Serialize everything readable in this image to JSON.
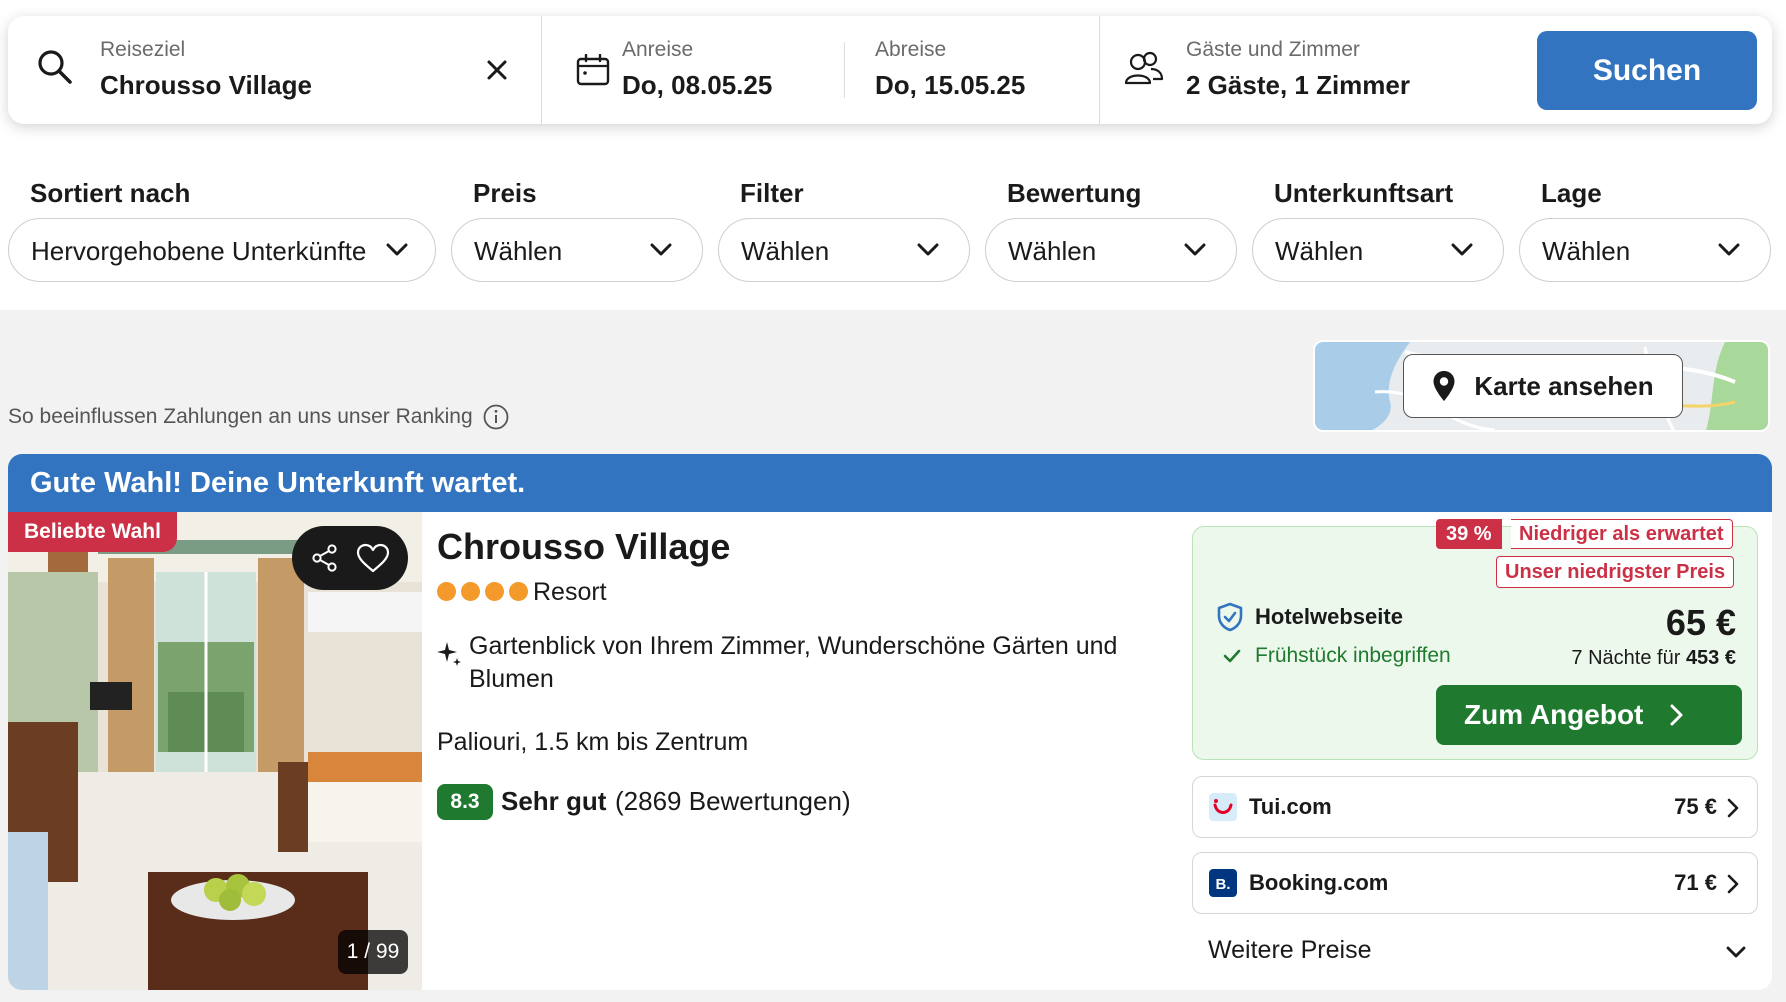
{
  "search": {
    "destination_label": "Reiseziel",
    "destination_value": "Chrousso Village",
    "checkin_label": "Anreise",
    "checkin_value": "Do, 08.05.25",
    "checkout_label": "Abreise",
    "checkout_value": "Do, 15.05.25",
    "guests_label": "Gäste und Zimmer",
    "guests_value": "2 Gäste, 1 Zimmer",
    "search_button": "Suchen"
  },
  "filters": [
    {
      "title": "Sortiert nach",
      "value": "Hervorgehobene Unterkünfte"
    },
    {
      "title": "Preis",
      "value": "Wählen"
    },
    {
      "title": "Filter",
      "value": "Wählen"
    },
    {
      "title": "Bewertung",
      "value": "Wählen"
    },
    {
      "title": "Unterkunftsart",
      "value": "Wählen"
    },
    {
      "title": "Lage",
      "value": "Wählen"
    }
  ],
  "ranking_note": "So beeinflussen Zahlungen an uns unser Ranking",
  "map_button": "Karte ansehen",
  "result": {
    "banner": "Gute Wahl! Deine Unterkunft wartet.",
    "popular_badge": "Beliebte Wahl",
    "photo_counter": "1 / 99",
    "name": "Chrousso Village",
    "star_count": 4,
    "type": "Resort",
    "feature": "Gartenblick von Ihrem Zimmer, Wunderschöne Gärten und Blumen",
    "location": "Paliouri, 1.5 km bis Zentrum",
    "score": "8.3",
    "score_label": "Sehr gut",
    "review_count": "(2869 Bewertungen)",
    "offer": {
      "discount_pct": "39 %",
      "discount_label": "Niedriger als erwartet",
      "lowest_label": "Unser niedrigster Preis",
      "provider": "Hotelwebseite",
      "breakfast": "Frühstück inbegriffen",
      "price": "65 €",
      "nights_prefix": "7 Nächte für",
      "nights_total": "453 €",
      "cta": "Zum Angebot"
    },
    "providers": [
      {
        "name": "Tui.com",
        "price": "75 €",
        "logo": "tui-logo",
        "color": "#e4002b"
      },
      {
        "name": "Booking.com",
        "price": "71 €",
        "logo": "booking-logo",
        "color": "#003580"
      }
    ],
    "more_prices": "Weitere Preise"
  },
  "colors": {
    "primary_blue": "#3274c0",
    "deal_green": "#1f7a2f",
    "badge_red": "#cc3046",
    "star_orange": "#f39a2a"
  }
}
